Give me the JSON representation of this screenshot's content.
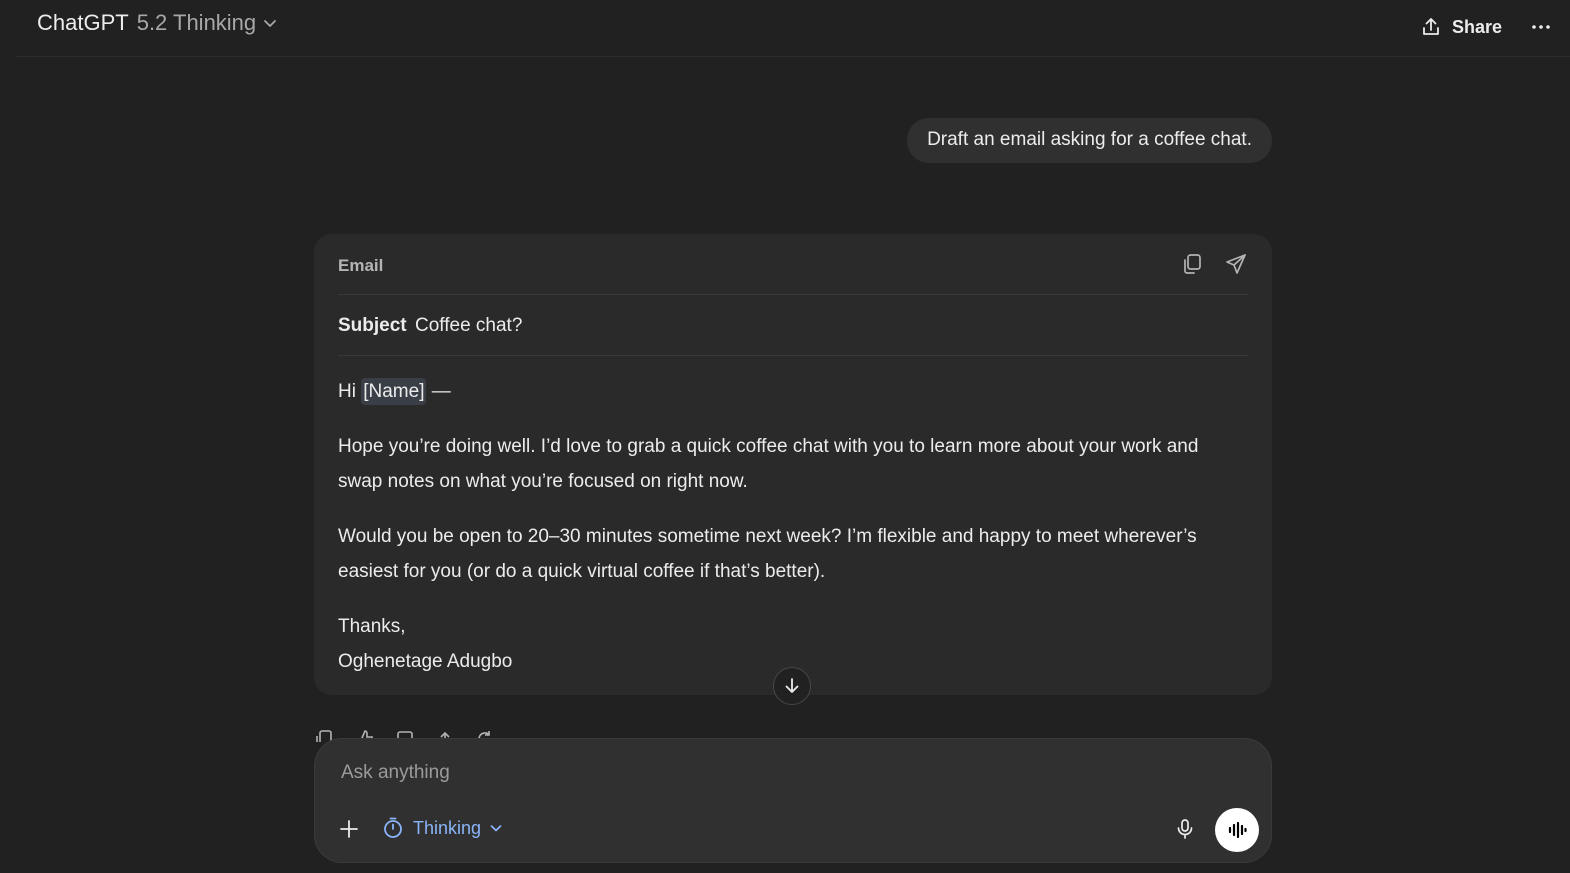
{
  "header": {
    "model_name": "ChatGPT",
    "model_version": "5.2 Thinking",
    "share_label": "Share"
  },
  "conversation": {
    "user_message": "Draft an email asking for a coffee chat."
  },
  "email": {
    "card_label": "Email",
    "subject_label": "Subject",
    "subject_value": "Coffee chat?",
    "greeting_prefix": "Hi ",
    "greeting_name": "[Name]",
    "greeting_suffix": " —",
    "paragraph1": "Hope you’re doing well. I’d love to grab a quick coffee chat with you to learn more about your work and swap notes on what you’re focused on right now.",
    "paragraph2": "Would you be open to 20–30 minutes sometime next week? I’m flexible and happy to meet wherever’s easiest for you (or do a quick virtual coffee if that’s better).",
    "signoff": "Thanks,",
    "signature": "Oghenetage Adugbo"
  },
  "composer": {
    "placeholder": "Ask anything",
    "mode_label": "Thinking"
  },
  "icons": {
    "model_chevron": "chevron-down-icon",
    "share": "share-icon",
    "more": "more-horizontal-icon",
    "copy": "copy-icon",
    "send": "send-icon",
    "scroll_down": "arrow-down-icon",
    "plus": "plus-icon",
    "thinking": "timer-icon",
    "mic": "microphone-icon",
    "voice": "voice-mode-icon"
  },
  "colors": {
    "background": "#212121",
    "card": "#2a2a2a",
    "accent_thinking": "#8ab4f8"
  }
}
